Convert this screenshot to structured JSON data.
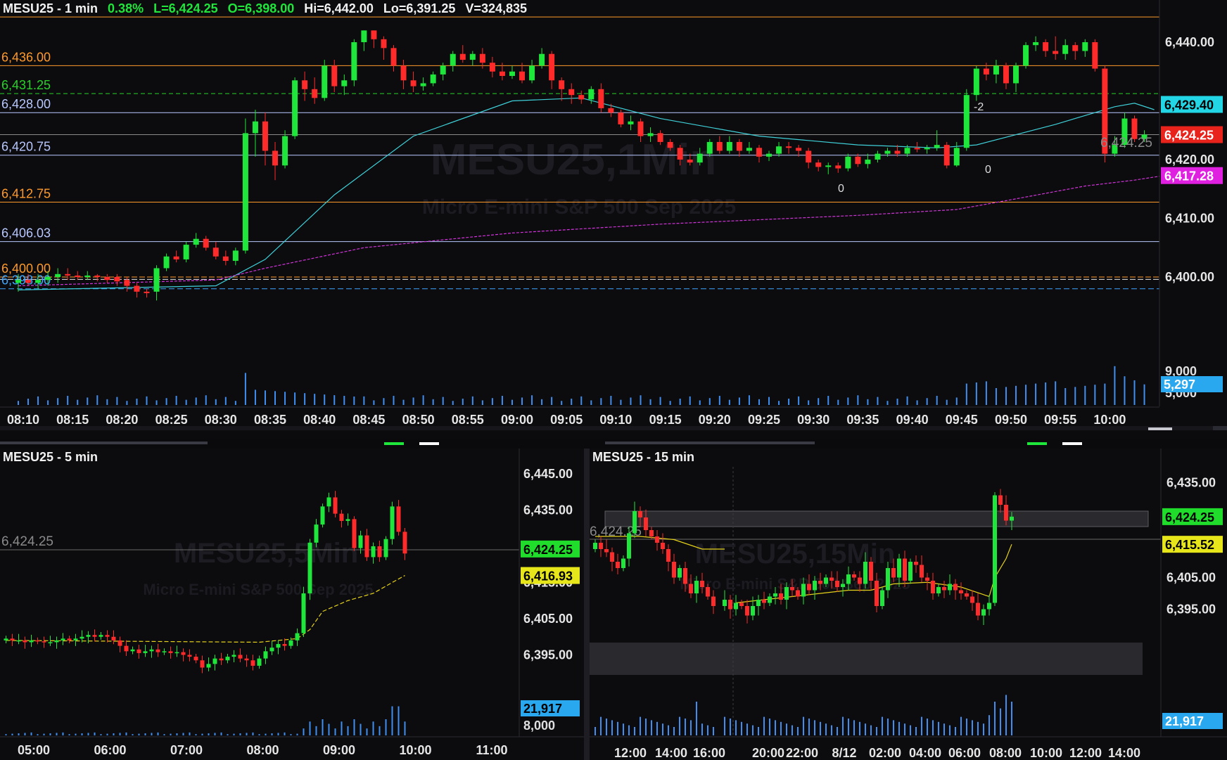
{
  "top": {
    "symbol": "MESU25 - 1 min",
    "change": "0.38%",
    "last": "L=6,424.25",
    "open": "O=6,398.00",
    "high": "Hi=6,442.00",
    "low": "Lo=6,391.25",
    "volume": "V=324,835",
    "watermark_title": "MESU25,1Min",
    "watermark_sub": "Micro E-mini S&P 500 Sep 2025",
    "level_labels": [
      {
        "text": "6,436.00",
        "price": 6436.0,
        "color": "#ff9a2a"
      },
      {
        "text": "6,431.25",
        "price": 6431.25,
        "color": "#29d12a"
      },
      {
        "text": "6,428.00",
        "price": 6428.0,
        "color": "#b8c8ff"
      },
      {
        "text": "6,420.75",
        "price": 6420.75,
        "color": "#b8c8ff"
      },
      {
        "text": "6,412.75",
        "price": 6412.75,
        "color": "#ff9a2a"
      },
      {
        "text": "6,406.03",
        "price": 6406.03,
        "color": "#b8c8ff"
      },
      {
        "text": "6,400.00",
        "price": 6400.0,
        "color": "#ff9a2a"
      },
      {
        "text": "6,398.00",
        "price": 6398.0,
        "color": "#3fa6ff"
      }
    ],
    "y_ticks": [
      "6,440.00",
      "6,430.00",
      "6,420.00",
      "6,410.00",
      "6,400.00"
    ],
    "y_tick_values": [
      6440,
      6430,
      6420,
      6410,
      6400
    ],
    "vol_tick": "9,000",
    "vol_tick2": "5,000",
    "vol_badge": "5,297",
    "x_ticks": [
      "08:10",
      "08:15",
      "08:20",
      "08:25",
      "08:30",
      "08:35",
      "08:40",
      "08:45",
      "08:50",
      "08:55",
      "09:00",
      "09:05",
      "09:10",
      "09:15",
      "09:20",
      "09:25",
      "09:30",
      "09:35",
      "09:40",
      "09:45",
      "09:50",
      "09:55",
      "10:00"
    ],
    "badges": [
      {
        "text": "6,429.40",
        "price": 6429.4,
        "bg": "#23d6e6",
        "fg": "#000000"
      },
      {
        "text": "6,424.25",
        "price": 6424.25,
        "bg": "#e8231c",
        "fg": "#ffffff"
      },
      {
        "text": "6,417.28",
        "price": 6417.28,
        "bg": "#e020e0",
        "fg": "#ffffff"
      }
    ],
    "last_price_label": "6,424.25",
    "annotations": [
      "-2",
      "0",
      "0"
    ]
  },
  "bottom_left": {
    "symbol": "MESU25 - 5 min",
    "watermark_title": "MESU25,5Min",
    "watermark_sub": "Micro E-mini S&P 500 Sep 2025",
    "last_price_label": "6,424.25",
    "y_ticks": [
      "6,445.00",
      "6,435.00",
      "6,415.00",
      "6,405.00",
      "6,395.00"
    ],
    "badges": [
      {
        "text": "6,424.25",
        "bg": "#1fdd2a",
        "fg": "#000000"
      },
      {
        "text": "6,416.93",
        "bg": "#e6e61a",
        "fg": "#000000"
      }
    ],
    "vol_badge": "21,917",
    "vol_tick": "8,000",
    "x_ticks": [
      "05:00",
      "06:00",
      "07:00",
      "08:00",
      "09:00",
      "10:00",
      "11:00"
    ]
  },
  "bottom_right": {
    "symbol": "MESU25 - 15 min",
    "watermark_title": "MESU25,15Min",
    "watermark_sub": "Micro E-mini S&P 500 Sep 2025",
    "last_price_label": "6,424.25",
    "y_ticks": [
      "6,435.00",
      "6,405.00",
      "6,395.00"
    ],
    "badges": [
      {
        "text": "6,424.25",
        "bg": "#1fdd2a",
        "fg": "#000000"
      },
      {
        "text": "6,415.52",
        "bg": "#e6e61a",
        "fg": "#000000"
      }
    ],
    "vol_badge": "21,917",
    "x_ticks": [
      "12:00",
      "14:00",
      "16:00",
      "20:00",
      "22:00",
      "8/12",
      "02:00",
      "04:00",
      "06:00",
      "08:00",
      "10:00",
      "12:00",
      "14:00"
    ]
  },
  "colors": {
    "up": "#1fe63a",
    "down": "#ff2a2a",
    "vwap": "#3fd0d8",
    "ma": "#d033d8",
    "ma_yellow": "#e6d21a"
  }
}
